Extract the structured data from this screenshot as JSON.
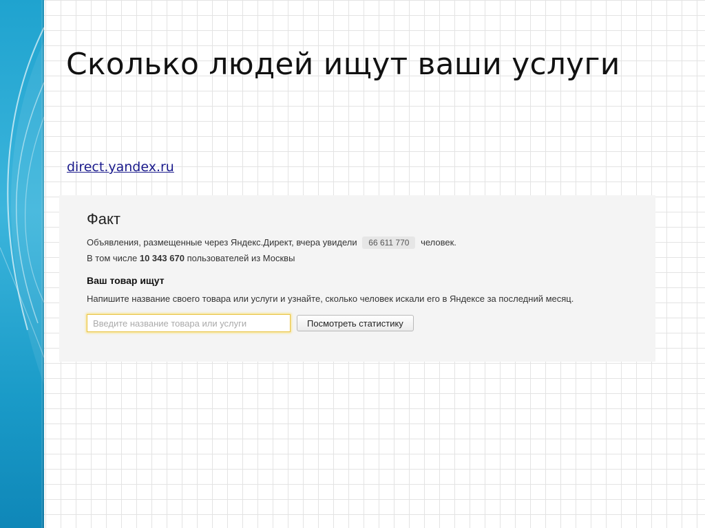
{
  "slide": {
    "title": "Сколько людей ищут ваши услуги",
    "link": "direct.yandex.ru"
  },
  "panel": {
    "heading": "Факт",
    "line1_before": "Объявления, размещенные через Яндекс.Директ, вчера увидели",
    "line1_count": "66 611 770",
    "line1_after": "человек.",
    "line2_before": "В том числе",
    "line2_count": "10 343 670",
    "line2_after": "пользователей из Москвы",
    "subheading": "Ваш товар ищут",
    "instruction": "Напишите название своего товара или услуги и узнайте, сколько человек искали его в Яндексе за последний месяц.",
    "search_placeholder": "Введите название товара или услуги",
    "search_value": "",
    "button_label": "Посмотреть статистику"
  },
  "colors": {
    "left_bar": "#1fa3cf",
    "link": "#1a1a8c",
    "input_focus": "#ffcc00",
    "panel_bg": "#f4f4f4"
  }
}
